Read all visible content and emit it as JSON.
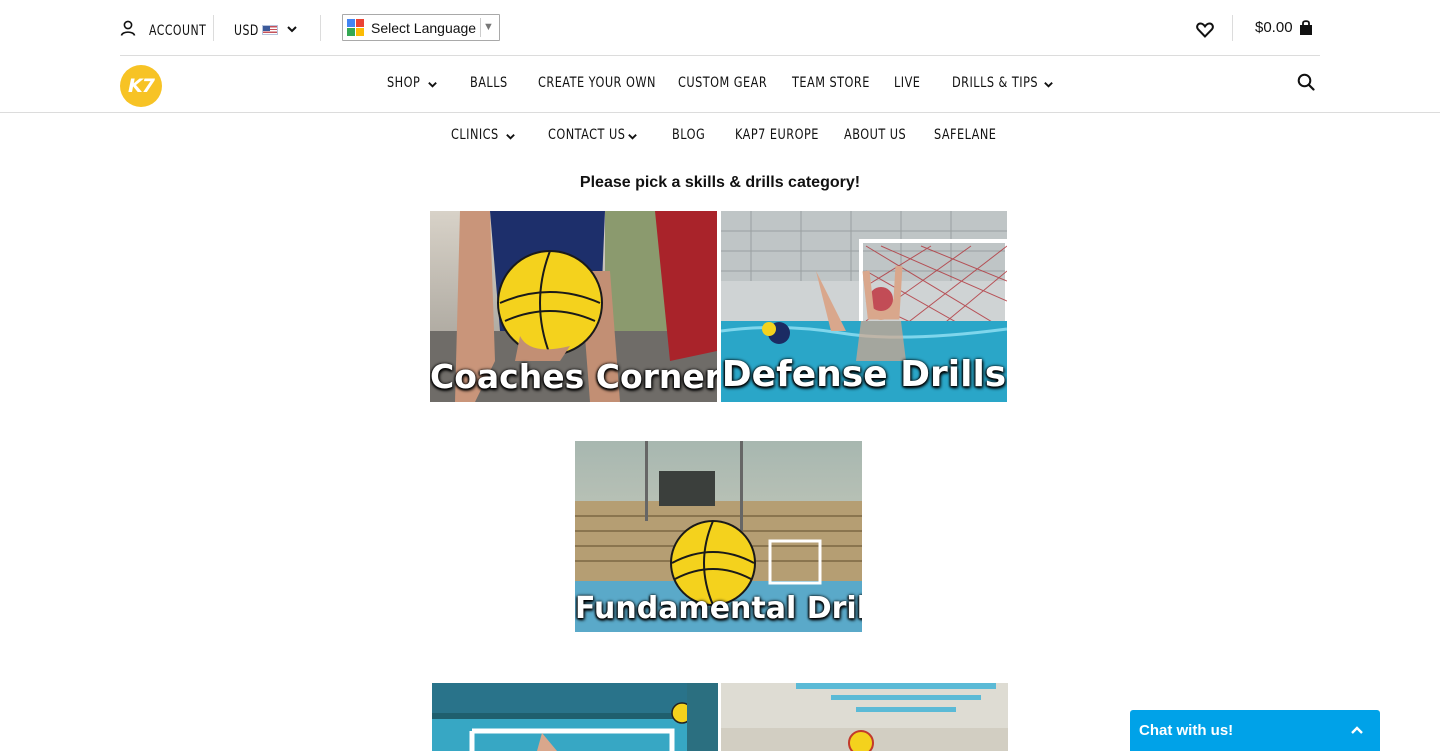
{
  "topbar": {
    "account_label": "ACCOUNT",
    "currency_label": "USD",
    "language_label": "Select Language",
    "cart_amount": "$0.00"
  },
  "logo": {
    "text": "K7"
  },
  "nav_primary": [
    "SHOP",
    "BALLS",
    "CREATE YOUR OWN",
    "CUSTOM GEAR",
    "TEAM STORE",
    "LIVE",
    "DRILLS & TIPS"
  ],
  "nav_secondary": [
    "CLINICS",
    "CONTACT US",
    "BLOG",
    "KAP7 EUROPE",
    "ABOUT US",
    "SAFELANE"
  ],
  "page": {
    "heading": "Please pick a skills & drills category!"
  },
  "tiles": [
    {
      "caption": "Coaches Corner"
    },
    {
      "caption": "Defense Drills"
    },
    {
      "caption": "Fundamental Drills"
    }
  ],
  "chat": {
    "label": "Chat with us!"
  },
  "colors": {
    "brand_yellow": "#f7c325",
    "chat_blue": "#00a2e8"
  }
}
